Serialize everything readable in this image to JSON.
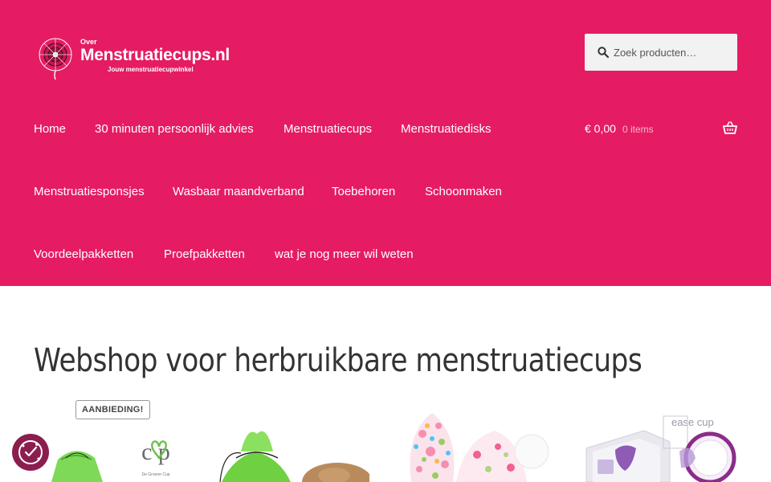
{
  "header": {
    "background": "#e51c63",
    "logo": {
      "over": "Over",
      "name": "Menstruatiecups.nl",
      "tagline": "Jouw menstruatiecupwinkel"
    },
    "search": {
      "placeholder": "Zoek producten…"
    }
  },
  "nav": {
    "items": [
      {
        "label": "Home",
        "active": true
      },
      {
        "label": "30 minuten persoonlijk advies"
      },
      {
        "label": "Menstruatiecups"
      },
      {
        "label": "Menstruatiedisks"
      },
      {
        "label": "Menstruatiesponsjes"
      },
      {
        "label": "Wasbaar maandverband"
      },
      {
        "label": "Toebehoren"
      },
      {
        "label": "Schoonmaken"
      },
      {
        "label": "Voordeelpakketten"
      },
      {
        "label": "Proefpakketten"
      },
      {
        "label": "wat je nog meer wil weten"
      }
    ]
  },
  "cart": {
    "amount": "€ 0,00",
    "count": "0 items",
    "icon": "basket-icon"
  },
  "main": {
    "title": "Webshop voor herbruikbare menstruatiecups",
    "sale_badge": "AANBIEDING!",
    "products": [
      {
        "image_text": "De Groene Cup",
        "icon": "product-image"
      },
      {
        "icon": "product-image"
      },
      {
        "icon": "product-image"
      },
      {
        "image_text": "ease cup",
        "icon": "product-image"
      }
    ]
  },
  "cookie": {
    "icon": "cookie-consent-icon",
    "color": "#8b1e4f"
  }
}
